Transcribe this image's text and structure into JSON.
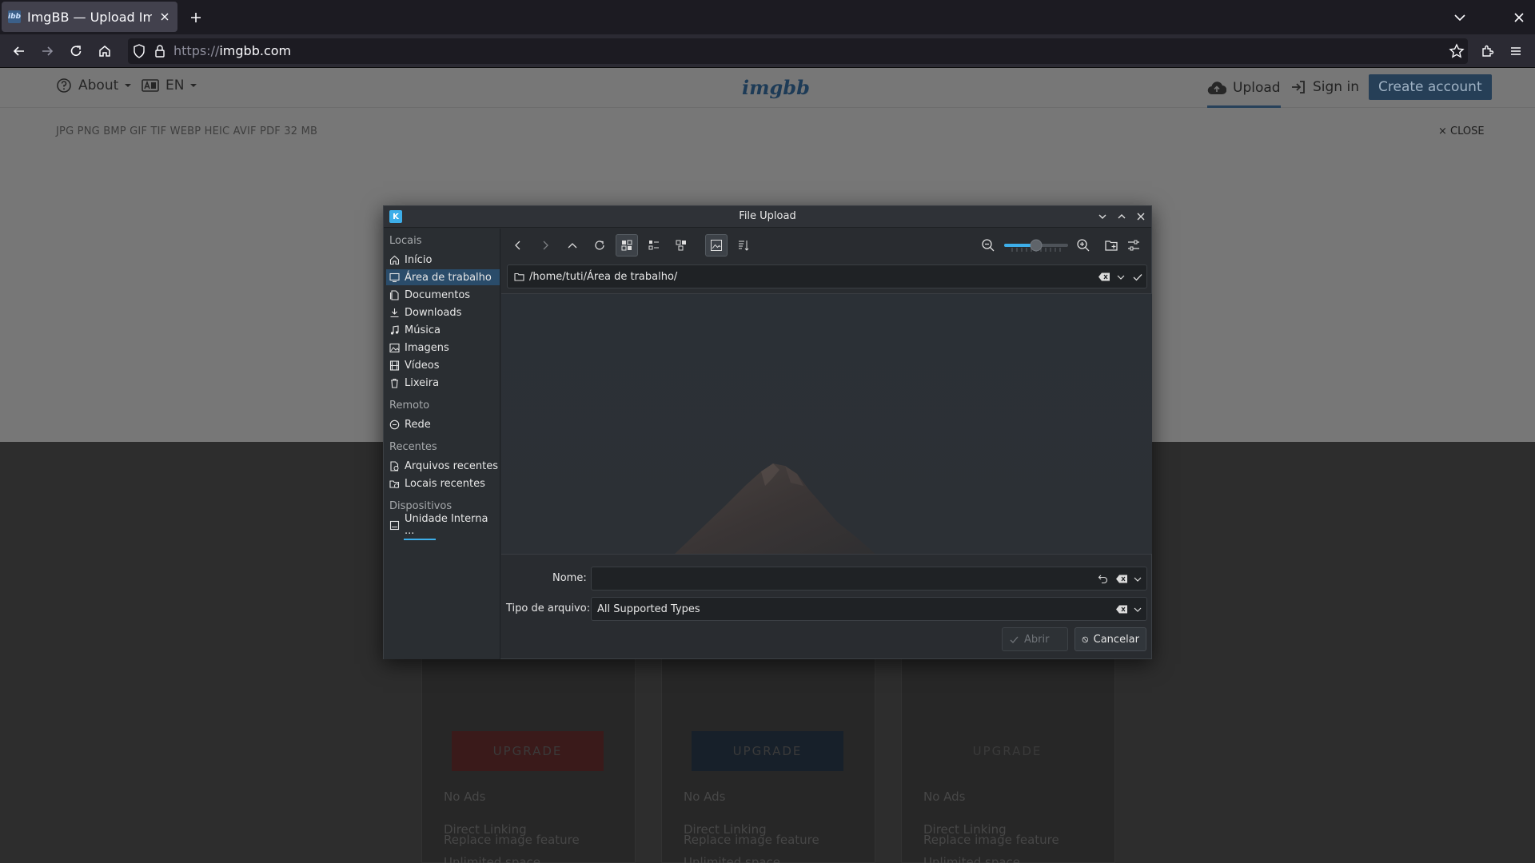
{
  "browser": {
    "tab_title": "ImgBB — Upload Image",
    "favicon_text": "ibb",
    "url_scheme": "https://",
    "url_host": "imgbb.com"
  },
  "site": {
    "about_label": "About",
    "lang_label": "EN",
    "logo_text": "imgbb",
    "upload_label": "Upload",
    "signin_label": "Sign in",
    "create_account_label": "Create account",
    "file_types": "JPG PNG BMP GIF TIF WEBP HEIC AVIF PDF  32 MB",
    "close_label": "× CLOSE",
    "plans": [
      {
        "upgrade_label": "UPGRADE",
        "accent": "#3a1a1a"
      },
      {
        "upgrade_label": "UPGRADE",
        "accent": "#17202a"
      },
      {
        "upgrade_label": "UPGRADE",
        "accent": "#272727"
      }
    ],
    "features": [
      "No Ads",
      "Direct Linking",
      "Unlimited space",
      "Replace image feature"
    ]
  },
  "dialog": {
    "title": "File Upload",
    "places": {
      "locais": {
        "heading": "Locais",
        "items": [
          {
            "label": "Início",
            "icon": "home-icon"
          },
          {
            "label": "Área de trabalho",
            "icon": "desktop-icon",
            "selected": true
          },
          {
            "label": "Documentos",
            "icon": "documents-icon"
          },
          {
            "label": "Downloads",
            "icon": "downloads-icon"
          },
          {
            "label": "Música",
            "icon": "music-icon"
          },
          {
            "label": "Imagens",
            "icon": "images-icon"
          },
          {
            "label": "Vídeos",
            "icon": "videos-icon"
          },
          {
            "label": "Lixeira",
            "icon": "trash-icon"
          }
        ]
      },
      "remoto": {
        "heading": "Remoto",
        "items": [
          {
            "label": "Rede",
            "icon": "network-icon"
          }
        ]
      },
      "recentes": {
        "heading": "Recentes",
        "items": [
          {
            "label": "Arquivos recentes",
            "icon": "recent-files-icon"
          },
          {
            "label": "Locais recentes",
            "icon": "recent-places-icon"
          }
        ]
      },
      "dispositivos": {
        "heading": "Dispositivos",
        "items": [
          {
            "label": "Unidade Interna ...",
            "icon": "drive-icon"
          }
        ]
      }
    },
    "path": "/home/tuti/Área de trabalho/",
    "name_label": "Nome:",
    "name_value": "",
    "filetype_label": "Tipo de arquivo:",
    "filetype_value": "All Supported Types",
    "open_label": "Abrir",
    "cancel_label": "Cancelar",
    "zoom_level": 0.5,
    "accent": "#3daee9"
  }
}
